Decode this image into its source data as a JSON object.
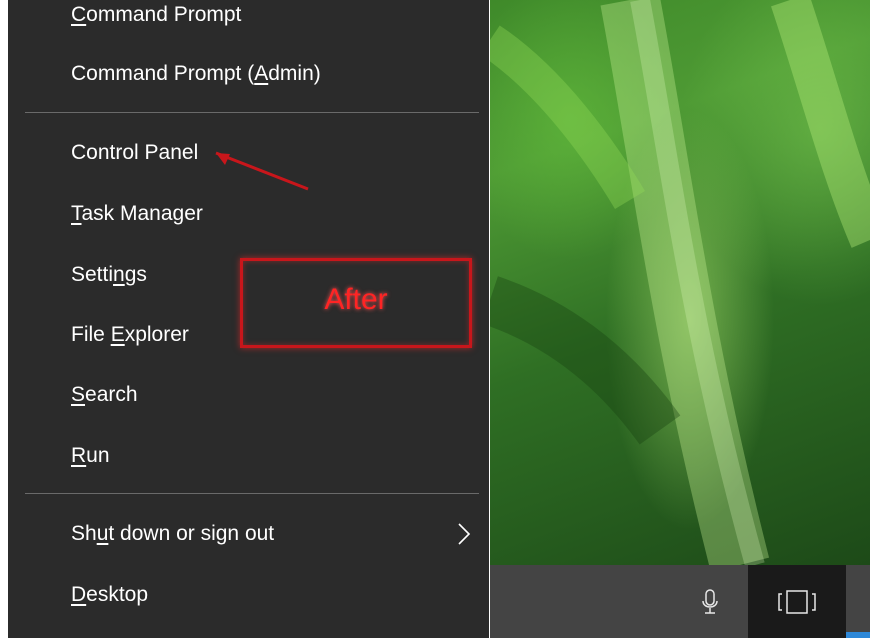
{
  "menu": {
    "items": [
      {
        "pre": "",
        "ul": "C",
        "post": "ommand Prompt"
      },
      {
        "pre": "Command Prompt (",
        "ul": "A",
        "post": "dmin)"
      },
      {
        "pre": "Control Panel",
        "ul": "",
        "post": ""
      },
      {
        "pre": "",
        "ul": "T",
        "post": "ask Manager"
      },
      {
        "pre": "Setti",
        "ul": "n",
        "post": "gs"
      },
      {
        "pre": "File ",
        "ul": "E",
        "post": "xplorer"
      },
      {
        "pre": "",
        "ul": "S",
        "post": "earch"
      },
      {
        "pre": "",
        "ul": "R",
        "post": "un"
      },
      {
        "pre": "Sh",
        "ul": "u",
        "post": "t down or sign out"
      },
      {
        "pre": "",
        "ul": "D",
        "post": "esktop"
      }
    ]
  },
  "annotation": {
    "label": "After",
    "color": "#e0191e"
  },
  "taskbar": {
    "icons": [
      "microphone-icon",
      "task-view-icon"
    ],
    "accent_color": "#2e88d8"
  }
}
